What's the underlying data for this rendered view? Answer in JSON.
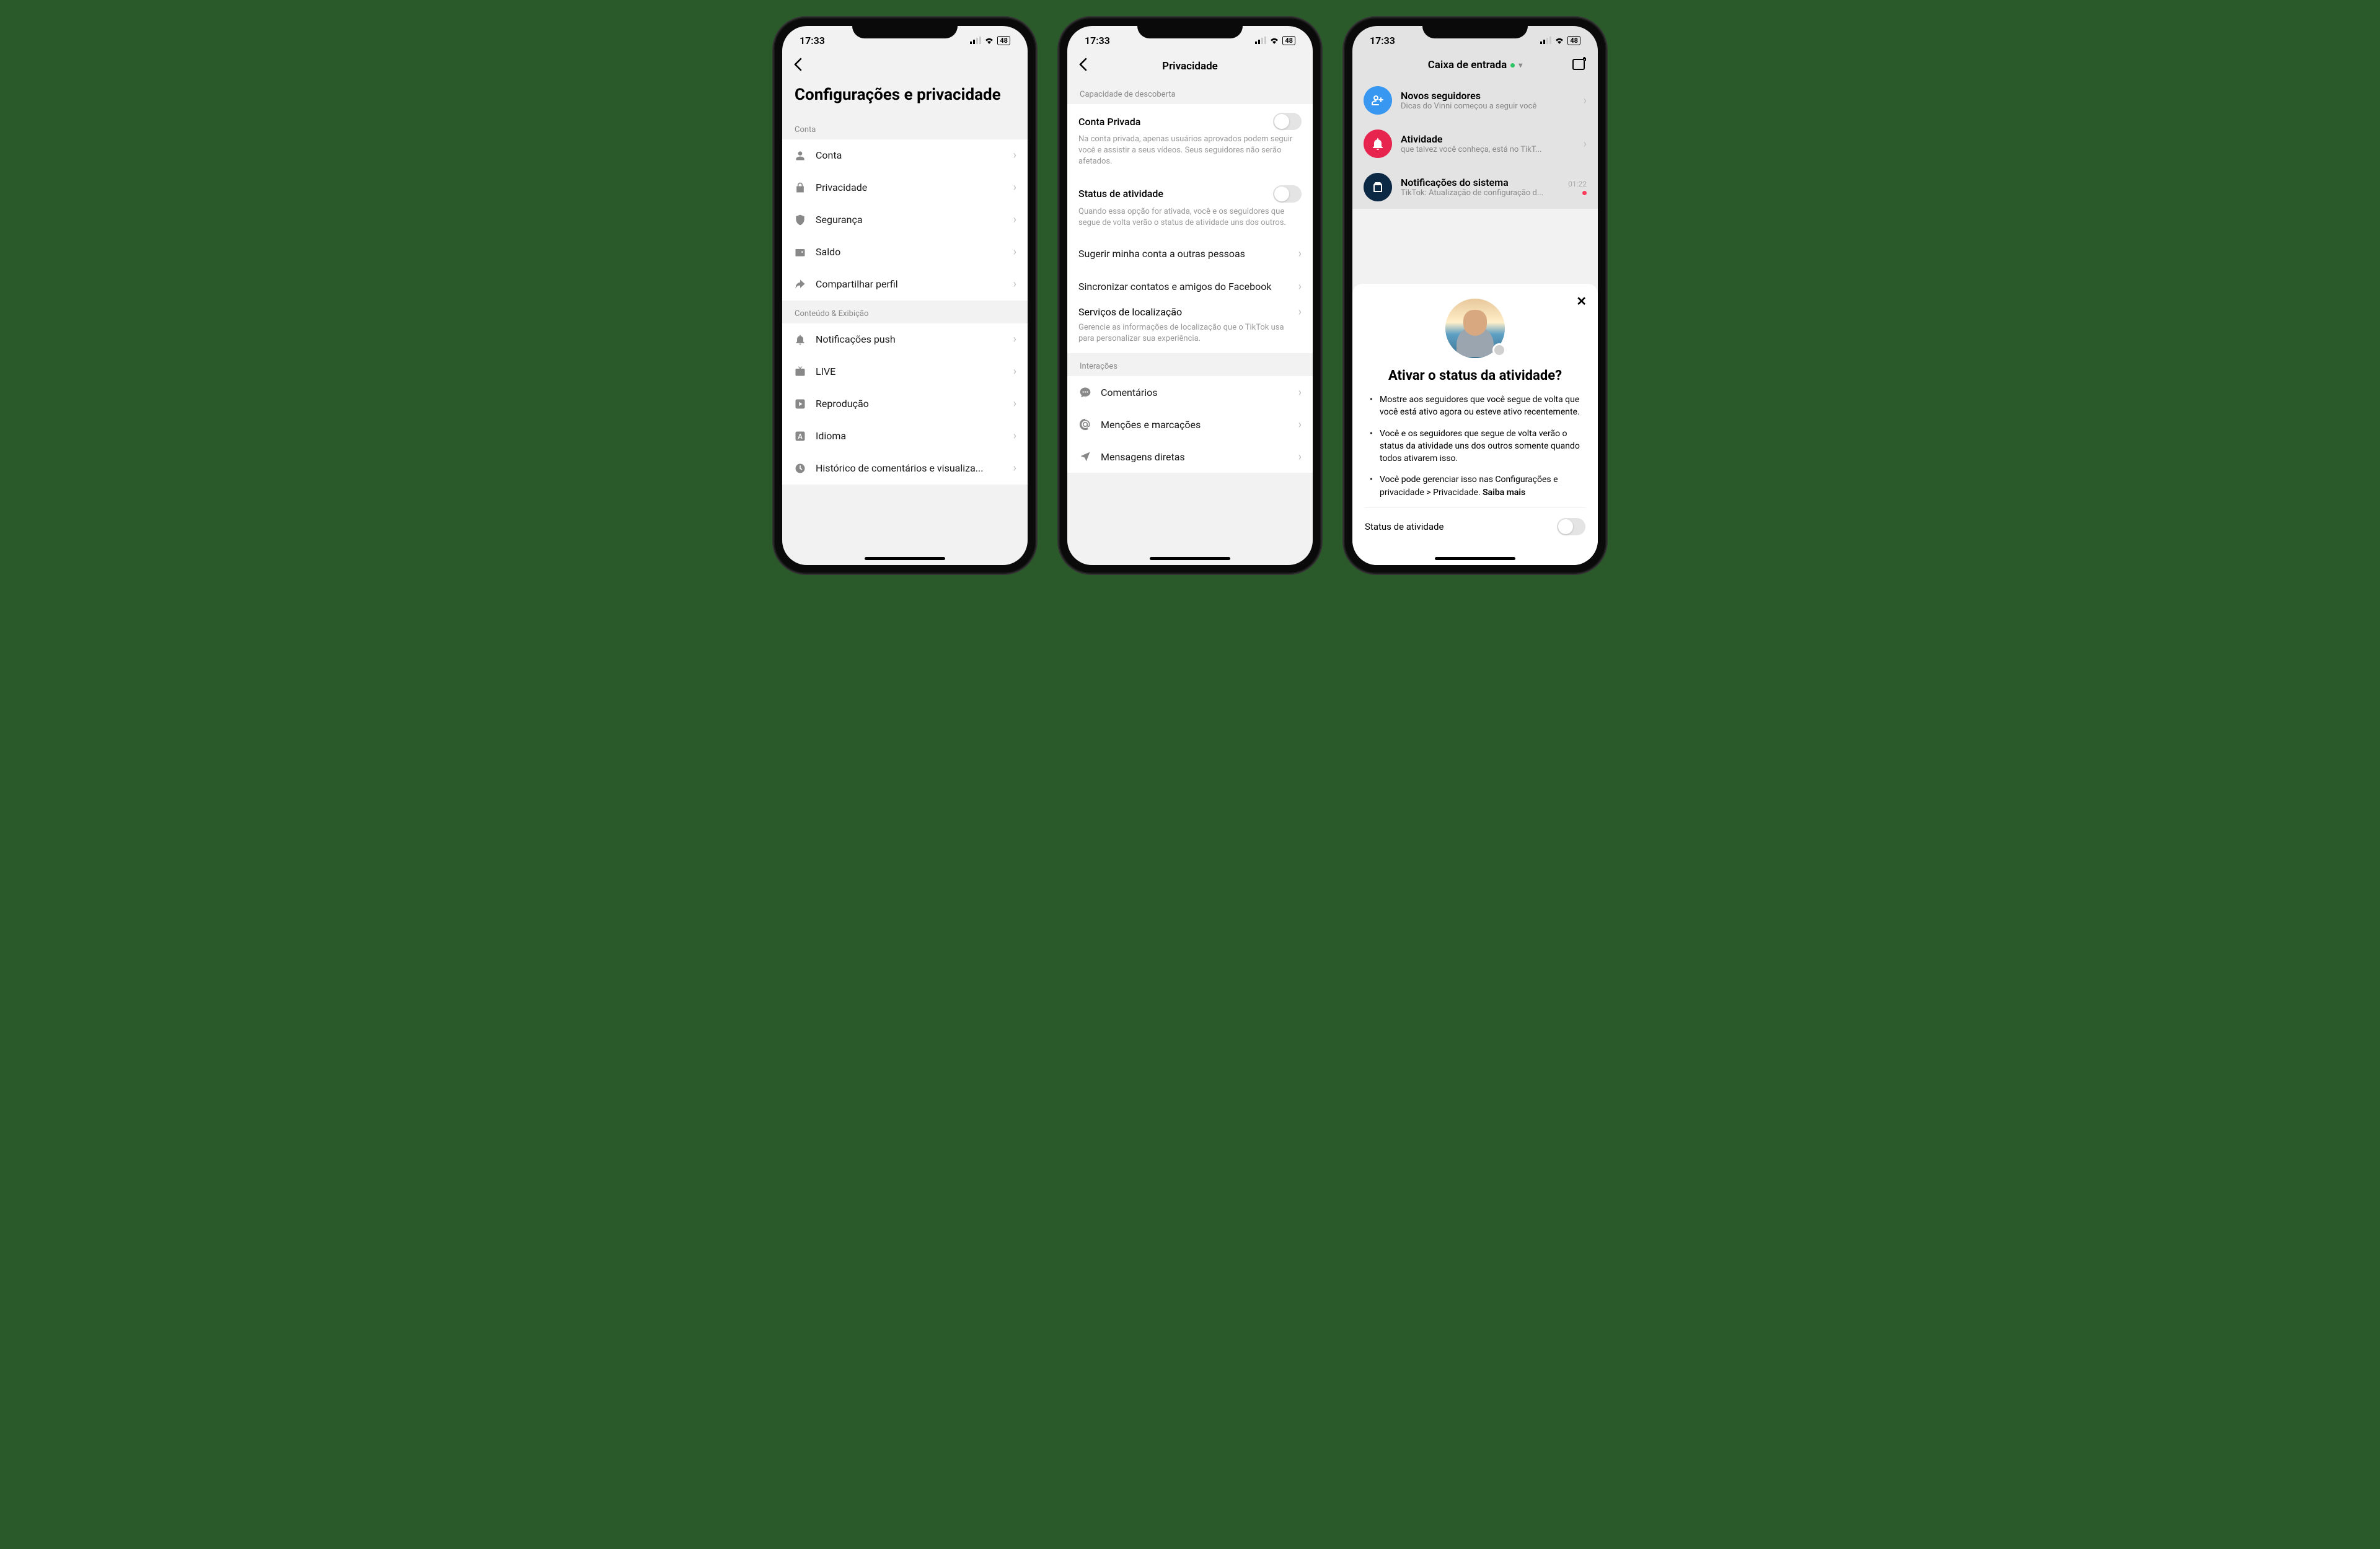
{
  "status": {
    "time": "17:33",
    "battery": "48"
  },
  "phone1": {
    "title": "Configurações e privacidade",
    "section1": "Conta",
    "items1": [
      {
        "label": "Conta"
      },
      {
        "label": "Privacidade"
      },
      {
        "label": "Segurança"
      },
      {
        "label": "Saldo"
      },
      {
        "label": "Compartilhar perfil"
      }
    ],
    "section2": "Conteúdo & Exibição",
    "items2": [
      {
        "label": "Notificações push"
      },
      {
        "label": "LIVE"
      },
      {
        "label": "Reprodução"
      },
      {
        "label": "Idioma"
      },
      {
        "label": "Histórico de comentários e visualiza..."
      }
    ]
  },
  "phone2": {
    "title": "Privacidade",
    "section1": "Capacidade de descoberta",
    "private": {
      "label": "Conta Privada",
      "desc": "Na conta privada, apenas usuários aprovados podem seguir você e assistir a seus vídeos. Seus seguidores não serão afetados."
    },
    "activity": {
      "label": "Status de atividade",
      "desc": "Quando essa opção for ativada, você e os seguidores que segue de volta verão o status de atividade uns dos outros."
    },
    "suggest": "Sugerir minha conta a outras pessoas",
    "sync": "Sincronizar contatos e amigos do Facebook",
    "location": {
      "label": "Serviços de localização",
      "desc": "Gerencie as informações de localização que o TikTok usa para personalizar sua experiência."
    },
    "section2": "Interações",
    "interactions": [
      {
        "label": "Comentários"
      },
      {
        "label": "Menções e marcações"
      },
      {
        "label": "Mensagens diretas"
      }
    ]
  },
  "phone3": {
    "inbox_title": "Caixa de entrada",
    "rows": [
      {
        "title": "Novos seguidores",
        "sub": "Dicas do Vinni começou a seguir você"
      },
      {
        "title": "Atividade",
        "sub": "que talvez você conheça, está no TikT..."
      },
      {
        "title": "Notificações do sistema",
        "sub": "TikTok: Atualização de configuração d...",
        "time": "01:22"
      }
    ],
    "sheet": {
      "title": "Ativar o status da atividade?",
      "bullets": [
        "Mostre aos seguidores que você segue de volta que você está ativo agora ou esteve ativo recentemente.",
        "Você e os seguidores que segue de volta verão o status da atividade uns dos outros somente quando todos ativarem isso.",
        "Você pode gerenciar isso nas Configurações e privacidade > Privacidade. "
      ],
      "learn_more": "Saiba mais",
      "toggle_label": "Status de atividade"
    }
  }
}
